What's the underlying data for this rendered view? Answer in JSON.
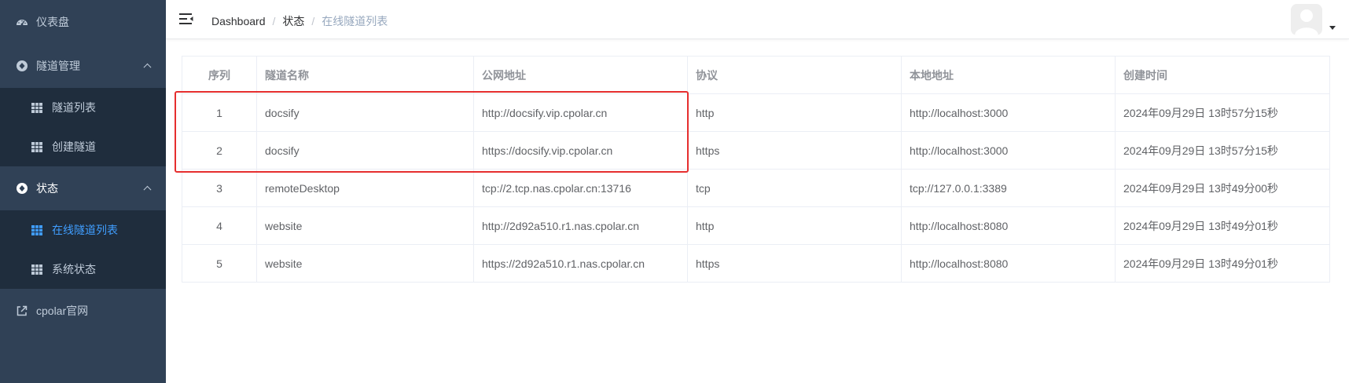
{
  "sidebar": {
    "dashboard": "仪表盘",
    "tunnel_mgmt": "隧道管理",
    "tunnel_list": "隧道列表",
    "create_tunnel": "创建隧道",
    "status": "状态",
    "online_tunnels": "在线隧道列表",
    "system_status": "系统状态",
    "official_site": "cpolar官网"
  },
  "breadcrumb": [
    "Dashboard",
    "状态",
    "在线隧道列表"
  ],
  "table": {
    "headers": [
      "序列",
      "隧道名称",
      "公网地址",
      "协议",
      "本地地址",
      "创建时间"
    ],
    "rows": [
      [
        "1",
        "docsify",
        "http://docsify.vip.cpolar.cn",
        "http",
        "http://localhost:3000",
        "2024年09月29日 13时57分15秒"
      ],
      [
        "2",
        "docsify",
        "https://docsify.vip.cpolar.cn",
        "https",
        "http://localhost:3000",
        "2024年09月29日 13时57分15秒"
      ],
      [
        "3",
        "remoteDesktop",
        "tcp://2.tcp.nas.cpolar.cn:13716",
        "tcp",
        "tcp://127.0.0.1:3389",
        "2024年09月29日 13时49分00秒"
      ],
      [
        "4",
        "website",
        "http://2d92a510.r1.nas.cpolar.cn",
        "http",
        "http://localhost:8080",
        "2024年09月29日 13时49分01秒"
      ],
      [
        "5",
        "website",
        "https://2d92a510.r1.nas.cpolar.cn",
        "https",
        "http://localhost:8080",
        "2024年09月29日 13时49分01秒"
      ]
    ]
  },
  "colors": {
    "sidebar_bg": "#304156",
    "submenu_bg": "#1f2d3d",
    "active": "#409eff",
    "highlight": "#e62e2e"
  }
}
